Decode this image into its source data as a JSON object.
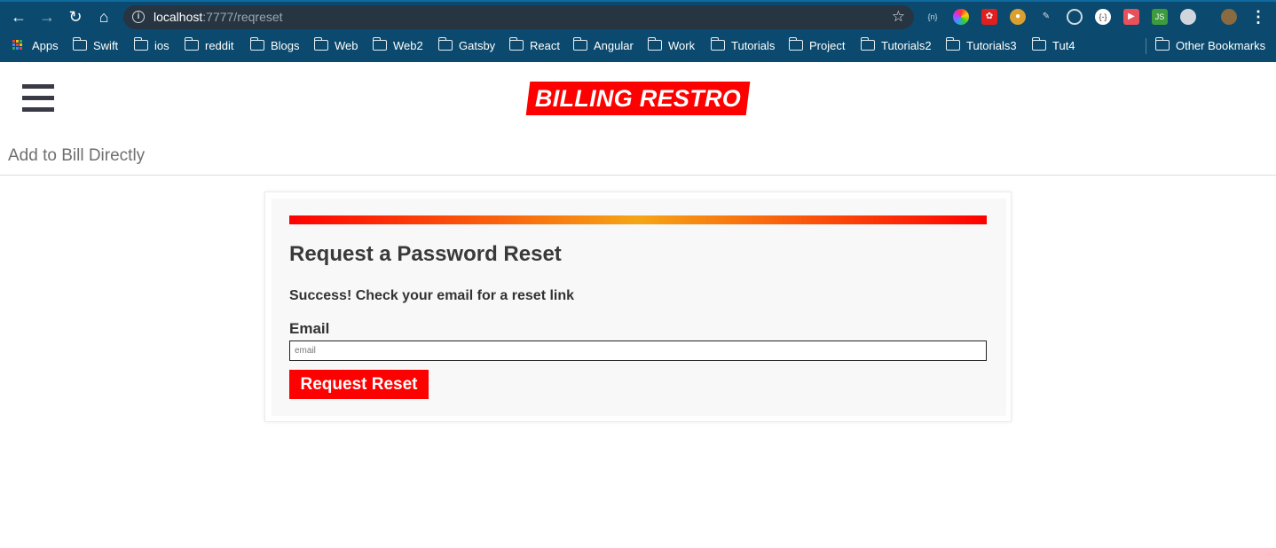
{
  "browser": {
    "url_host": "localhost",
    "url_path": ":7777/reqreset",
    "bookmarks": [
      {
        "label": "Apps"
      },
      {
        "label": "Swift"
      },
      {
        "label": "ios"
      },
      {
        "label": "reddit"
      },
      {
        "label": "Blogs"
      },
      {
        "label": "Web"
      },
      {
        "label": "Web2"
      },
      {
        "label": "Gatsby"
      },
      {
        "label": "React"
      },
      {
        "label": "Angular"
      },
      {
        "label": "Work"
      },
      {
        "label": "Tutorials"
      },
      {
        "label": "Project"
      },
      {
        "label": "Tutorials2"
      },
      {
        "label": "Tutorials3"
      },
      {
        "label": "Tut4"
      }
    ],
    "other_bookmarks": "Other Bookmarks"
  },
  "header": {
    "logo_text": "BILLING RESTRO",
    "add_link": "Add to Bill Directly"
  },
  "form": {
    "title": "Request a Password Reset",
    "success_message": "Success! Check your email for a reset link",
    "email_label": "Email",
    "email_placeholder": "email",
    "email_value": "",
    "submit_label": "Request Reset"
  },
  "colors": {
    "brand_red": "#ff0000",
    "gradient_mid": "#f5a516",
    "chrome_bg": "#0b4a6e"
  }
}
